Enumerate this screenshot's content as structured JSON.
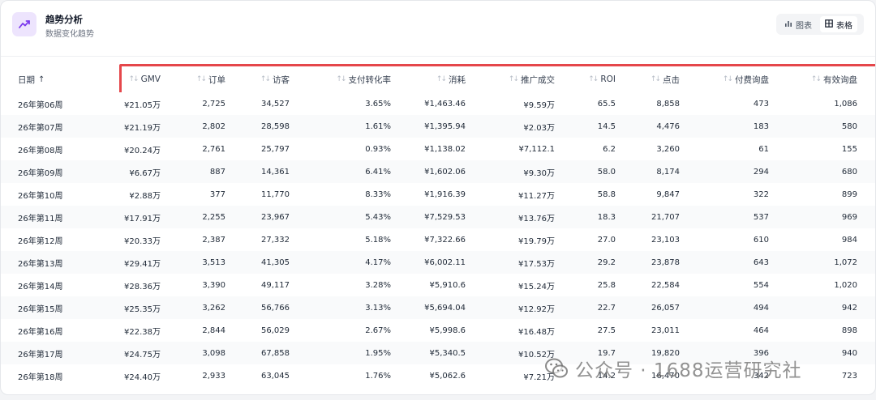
{
  "header": {
    "title": "趋势分析",
    "subtitle": "数据变化趋势",
    "icon": "trending-up-icon",
    "accent_color": "#7c3aed"
  },
  "view_toggle": {
    "chart_label": "图表",
    "table_label": "表格",
    "active": "table"
  },
  "table": {
    "columns": [
      {
        "key": "date",
        "label": "日期",
        "sort": "asc"
      },
      {
        "key": "gmv",
        "label": "GMV"
      },
      {
        "key": "orders",
        "label": "订单"
      },
      {
        "key": "visitors",
        "label": "访客"
      },
      {
        "key": "pay_rate",
        "label": "支付转化率"
      },
      {
        "key": "spend",
        "label": "消耗"
      },
      {
        "key": "promo_deal",
        "label": "推广成交"
      },
      {
        "key": "roi",
        "label": "ROI"
      },
      {
        "key": "clicks",
        "label": "点击"
      },
      {
        "key": "paid_inquiry",
        "label": "付费询盘"
      },
      {
        "key": "valid_inquiry",
        "label": "有效询盘"
      }
    ],
    "rows": [
      [
        "26年第06周",
        "¥21.05万",
        "2,725",
        "34,527",
        "3.65%",
        "¥1,463.46",
        "¥9.59万",
        "65.5",
        "8,858",
        "473",
        "1,086"
      ],
      [
        "26年第07周",
        "¥21.19万",
        "2,802",
        "28,598",
        "1.61%",
        "¥1,395.94",
        "¥2.03万",
        "14.5",
        "4,476",
        "183",
        "580"
      ],
      [
        "26年第08周",
        "¥20.24万",
        "2,761",
        "25,797",
        "0.93%",
        "¥1,138.02",
        "¥7,112.1",
        "6.2",
        "3,260",
        "61",
        "155"
      ],
      [
        "26年第09周",
        "¥6.67万",
        "887",
        "14,361",
        "6.41%",
        "¥1,602.06",
        "¥9.30万",
        "58.0",
        "8,174",
        "294",
        "680"
      ],
      [
        "26年第10周",
        "¥2.88万",
        "377",
        "11,770",
        "8.33%",
        "¥1,916.39",
        "¥11.27万",
        "58.8",
        "9,847",
        "322",
        "899"
      ],
      [
        "26年第11周",
        "¥17.91万",
        "2,255",
        "23,967",
        "5.43%",
        "¥7,529.53",
        "¥13.76万",
        "18.3",
        "21,707",
        "537",
        "969"
      ],
      [
        "26年第12周",
        "¥20.33万",
        "2,387",
        "27,332",
        "5.18%",
        "¥7,322.66",
        "¥19.79万",
        "27.0",
        "23,103",
        "610",
        "984"
      ],
      [
        "26年第13周",
        "¥29.41万",
        "3,513",
        "41,305",
        "4.17%",
        "¥6,002.11",
        "¥17.53万",
        "29.2",
        "23,878",
        "643",
        "1,072"
      ],
      [
        "26年第14周",
        "¥28.36万",
        "3,390",
        "49,117",
        "3.28%",
        "¥5,910.6",
        "¥15.24万",
        "25.8",
        "22,584",
        "554",
        "1,020"
      ],
      [
        "26年第15周",
        "¥25.35万",
        "3,262",
        "56,766",
        "3.13%",
        "¥5,694.04",
        "¥12.92万",
        "22.7",
        "26,057",
        "494",
        "942"
      ],
      [
        "26年第16周",
        "¥22.38万",
        "2,844",
        "56,029",
        "2.67%",
        "¥5,998.6",
        "¥16.48万",
        "27.5",
        "23,011",
        "464",
        "898"
      ],
      [
        "26年第17周",
        "¥24.75万",
        "3,098",
        "67,858",
        "1.95%",
        "¥5,340.5",
        "¥10.52万",
        "19.7",
        "19,820",
        "396",
        "940"
      ],
      [
        "26年第18周",
        "¥24.40万",
        "2,933",
        "63,045",
        "1.76%",
        "¥5,062.6",
        "¥7.21万",
        "14.2",
        "16,470",
        "342",
        "723"
      ]
    ]
  },
  "highlight_color": "#e5474b",
  "watermark": {
    "text": "公众号 · 1688运营研究社",
    "icon": "wechat-icon"
  }
}
